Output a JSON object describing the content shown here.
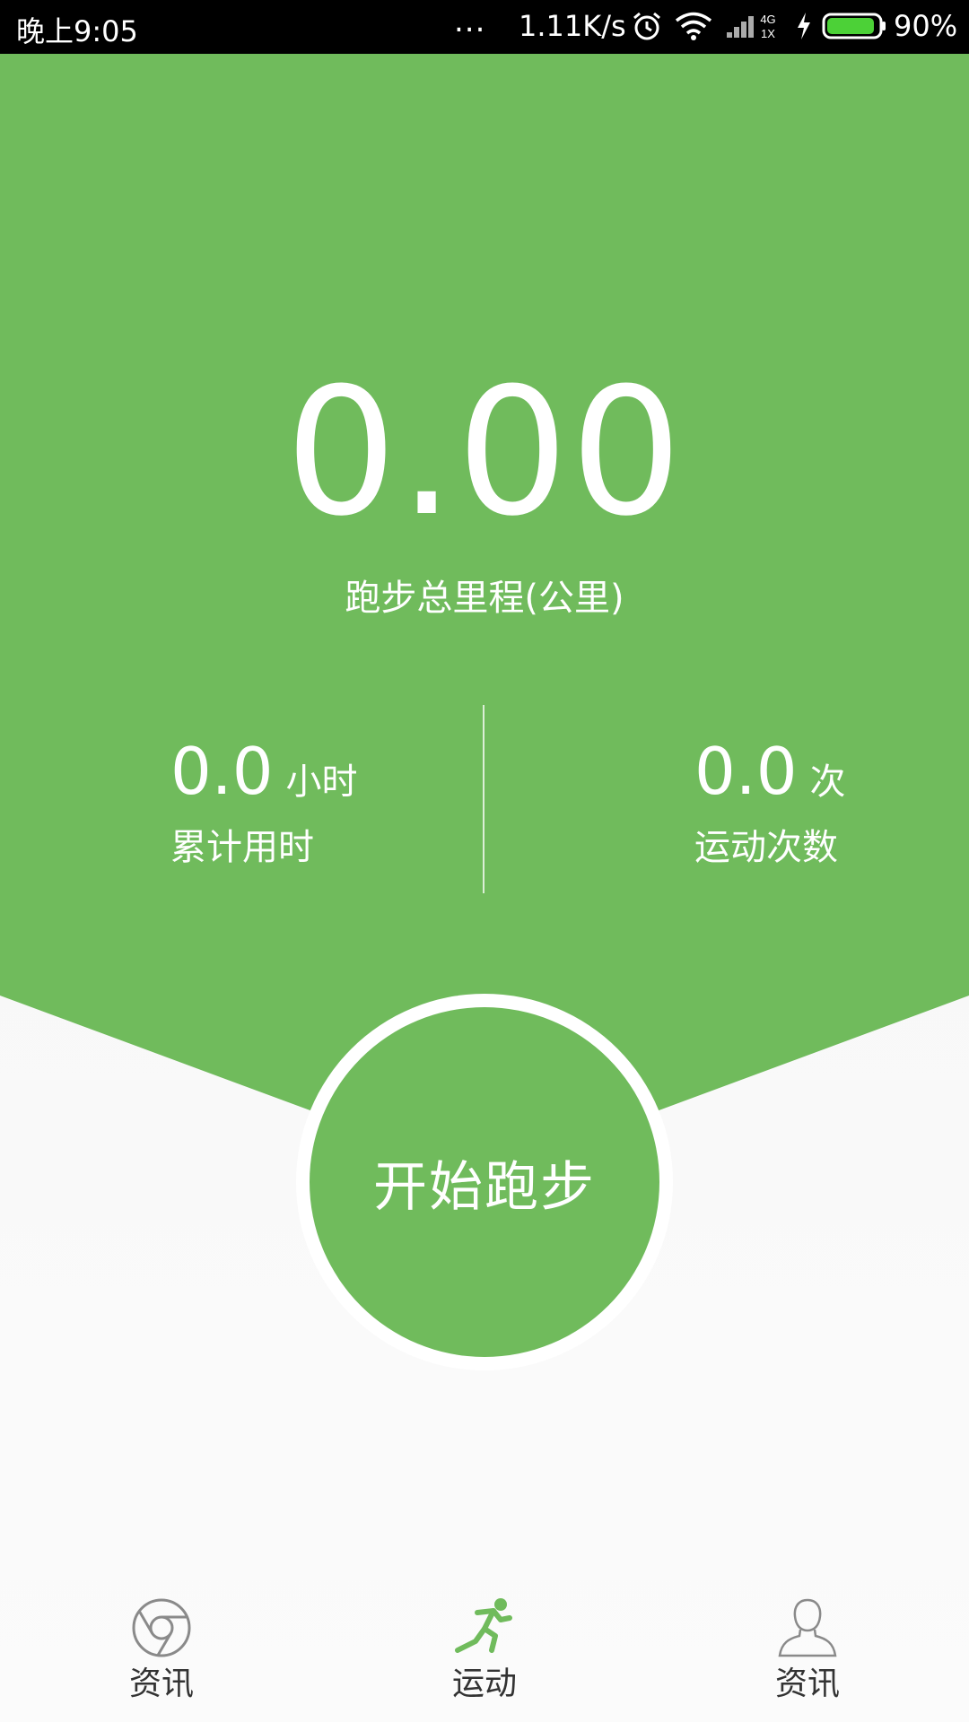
{
  "status_bar": {
    "time": "晚上9:05",
    "dots": "...",
    "network_speed": "1.11K/s",
    "signal_tags": "4G\n1X",
    "battery": "90%"
  },
  "summary": {
    "total_distance": "0.00",
    "total_distance_label": "跑步总里程(公里)",
    "time_value": "0.0",
    "time_unit": "小时",
    "time_label": "累计用时",
    "count_value": "0.0",
    "count_unit": "次",
    "count_label": "运动次数"
  },
  "start_button_label": "开始跑步",
  "nav": {
    "items": [
      {
        "label": "资讯",
        "icon": "chrome-icon",
        "active": false
      },
      {
        "label": "运动",
        "icon": "runner-icon",
        "active": true
      },
      {
        "label": "资讯",
        "icon": "person-icon",
        "active": false
      }
    ]
  },
  "colors": {
    "brand_green": "#70bb5c",
    "nav_text": "#333333",
    "nav_icon_inactive": "#8a8a8a"
  }
}
